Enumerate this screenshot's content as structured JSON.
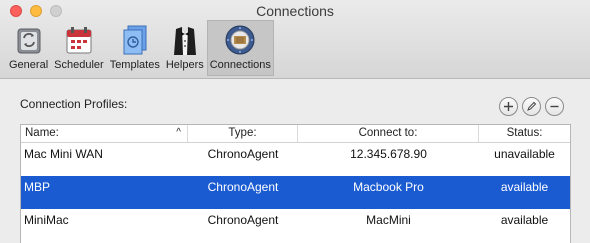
{
  "window": {
    "title": "Connections"
  },
  "toolbar": {
    "items": [
      {
        "label": "General",
        "icon": "general-switch-icon"
      },
      {
        "label": "Scheduler",
        "icon": "calendar-icon"
      },
      {
        "label": "Templates",
        "icon": "templates-document-icon"
      },
      {
        "label": "Helpers",
        "icon": "tuxedo-icon"
      },
      {
        "label": "Connections",
        "icon": "connections-globe-icon",
        "selected": true
      }
    ]
  },
  "profiles": {
    "label": "Connection Profiles:",
    "buttons": {
      "add": "add-icon",
      "edit": "pencil-icon",
      "remove": "minus-icon"
    },
    "columns": [
      "Name:",
      "Type:",
      "Connect to:",
      "Status:"
    ],
    "rows": [
      {
        "name": "Mac Mini WAN",
        "type": "ChronoAgent",
        "connect_to": "12.345.678.90",
        "status": "unavailable"
      },
      {
        "name": "MBP",
        "type": "ChronoAgent",
        "connect_to": "Macbook Pro",
        "status": "available",
        "selected": true
      },
      {
        "name": "MiniMac",
        "type": "ChronoAgent",
        "connect_to": "MacMini",
        "status": "available"
      }
    ]
  },
  "colors": {
    "selection": "#1a5bd2",
    "close": "#fc605c",
    "minimize": "#fdbc40"
  }
}
